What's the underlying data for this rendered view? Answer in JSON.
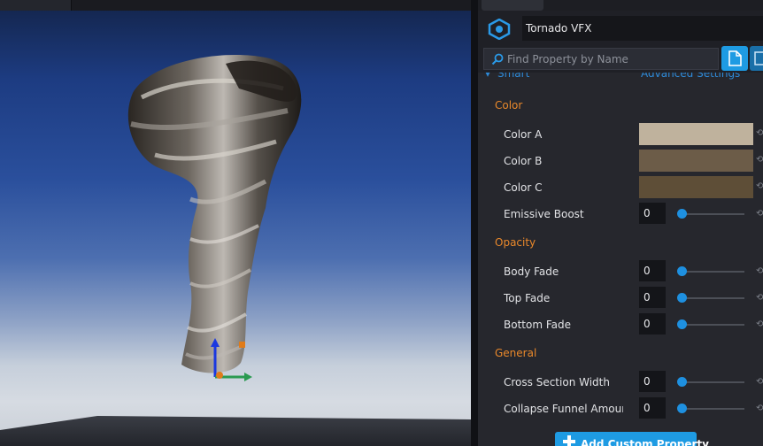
{
  "object": {
    "name": "Tornado VFX",
    "icon": "vfx-hexagon-icon"
  },
  "search": {
    "placeholder": "Find Property by Name"
  },
  "header": {
    "left": "Smart",
    "right": "Advanced Settings"
  },
  "sections": {
    "color": "Color",
    "opacity": "Opacity",
    "general": "General"
  },
  "properties": {
    "color_a": {
      "label": "Color A",
      "color": "#bfb29d"
    },
    "color_b": {
      "label": "Color B",
      "color": "#6c5c48"
    },
    "color_c": {
      "label": "Color C",
      "color": "#5e4e37"
    },
    "emissive_boost": {
      "label": "Emissive Boost",
      "value": "0"
    },
    "body_fade": {
      "label": "Body Fade",
      "value": "0"
    },
    "top_fade": {
      "label": "Top Fade",
      "value": "0"
    },
    "bottom_fade": {
      "label": "Bottom Fade",
      "value": "0"
    },
    "cross_section_width": {
      "label": "Cross Section Width",
      "value": "0"
    },
    "collapse_funnel_amount": {
      "label": "Collapse Funnel Amount",
      "value": "0"
    }
  },
  "buttons": {
    "add_custom_property": "Add Custom Property"
  },
  "colors": {
    "accent": "#1e9be3",
    "section": "#e9882b"
  }
}
